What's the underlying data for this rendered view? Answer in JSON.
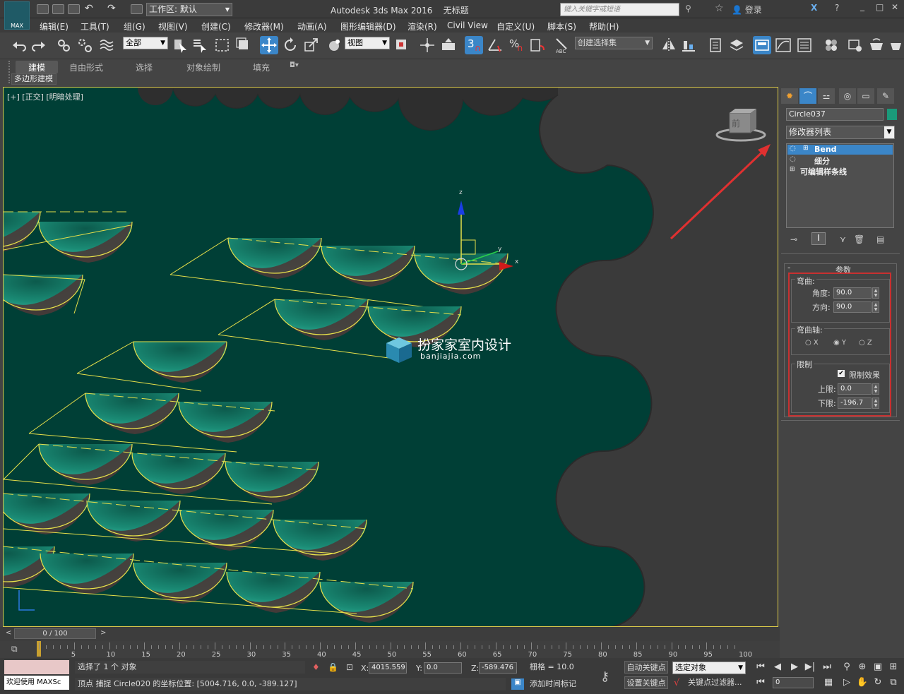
{
  "title_bar": {
    "app_title": "Autodesk 3ds Max 2016",
    "file_title": "无标题",
    "logo_text": "MAX",
    "workspace": "工作区: 默认",
    "search_placeholder": "键入关键字或短语",
    "login": "登录"
  },
  "menu": [
    "编辑(E)",
    "工具(T)",
    "组(G)",
    "视图(V)",
    "创建(C)",
    "修改器(M)",
    "动画(A)",
    "图形编辑器(D)",
    "渲染(R)",
    "Civil View",
    "自定义(U)",
    "脚本(S)",
    "帮助(H)"
  ],
  "toolbar": {
    "selection_filter": "全部",
    "ref_coord": "视图",
    "snap_number": "3",
    "named_selection": "创建选择集"
  },
  "ribbon": {
    "tabs": [
      "建模",
      "自由形式",
      "选择",
      "对象绘制",
      "填充"
    ],
    "subtab": "多边形建模"
  },
  "viewport": {
    "label": "[+] [正交] [明暗处理]",
    "watermark_cn": "扮家家室内设计",
    "watermark_en": "banjiajia.com",
    "gizmo_z": "z",
    "gizmo_y": "y",
    "gizmo_x": "x",
    "viewcube_face": "前"
  },
  "command_panel": {
    "object_name": "Circle037",
    "object_color": "#1a9a7a",
    "modifier_list": "修改器列表",
    "stack": [
      {
        "label": "Bend",
        "selected": true
      },
      {
        "label": "细分",
        "selected": false
      },
      {
        "label": "可编辑样条线",
        "selected": false
      }
    ],
    "params": {
      "rollout_title": "参数",
      "bend_group": "弯曲:",
      "angle_label": "角度:",
      "angle_value": "90.0",
      "direction_label": "方向:",
      "direction_value": "90.0",
      "axis_group": "弯曲轴:",
      "axis_x": "X",
      "axis_y": "Y",
      "axis_z": "Z",
      "axis_selected": "Y",
      "limit_group": "限制",
      "limit_effect": "限制效果",
      "limit_effect_checked": true,
      "upper_label": "上限:",
      "upper_value": "0.0",
      "lower_label": "下限:",
      "lower_value": "-196.7"
    }
  },
  "timeline": {
    "frame_counter": "0 / 100",
    "ticks": [
      "0",
      "5",
      "10",
      "15",
      "20",
      "25",
      "30",
      "35",
      "40",
      "45",
      "50",
      "55",
      "60",
      "65",
      "70",
      "75",
      "80",
      "85",
      "90",
      "95",
      "100"
    ]
  },
  "status": {
    "welcome": "欢迎使用 MAXSc",
    "selection": "选择了 1 个 对象",
    "prompt": "顶点 捕捉 Circle020 的坐标位置: [5004.716, 0.0, -389.127]",
    "x_label": "X:",
    "x_value": "4015.559",
    "y_label": "Y:",
    "y_value": "0.0",
    "z_label": "Z:",
    "z_value": "-589.476",
    "grid": "栅格 = 10.0",
    "add_time_tag": "添加时间标记",
    "auto_key": "自动关键点",
    "set_key": "设置关键点",
    "key_mode": "选定对象",
    "key_filters": "关键点过滤器...",
    "current_frame": "0"
  }
}
